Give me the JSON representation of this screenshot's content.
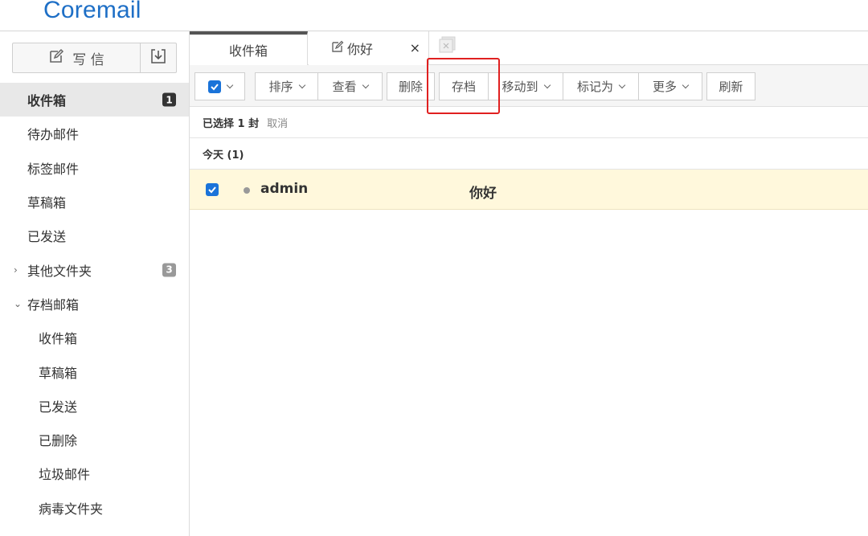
{
  "brand": {
    "logo_text": "Coremail",
    "accent": "#1e6fc6"
  },
  "sidebar": {
    "compose_label": "写 信",
    "compose_icon": "edit-icon",
    "import_icon": "import-icon",
    "items": [
      {
        "label": "收件箱",
        "badge": "1",
        "active": true
      },
      {
        "label": "待办邮件"
      },
      {
        "label": "标签邮件"
      },
      {
        "label": "草稿箱"
      },
      {
        "label": "已发送"
      },
      {
        "label": "其他文件夹",
        "badge": "3",
        "caret": "›"
      },
      {
        "label": "存档邮箱",
        "caret": "⌄"
      }
    ],
    "archive_items": [
      {
        "label": "收件箱"
      },
      {
        "label": "草稿箱"
      },
      {
        "label": "已发送"
      },
      {
        "label": "已删除"
      },
      {
        "label": "垃圾邮件"
      },
      {
        "label": "病毒文件夹"
      }
    ]
  },
  "tabs": [
    {
      "label": "收件箱",
      "active": true
    },
    {
      "label": "你好",
      "close": "×"
    }
  ],
  "toolbar": {
    "sort": "排序",
    "view": "查看",
    "delete": "删除",
    "archive": "存档",
    "move_to": "移动到",
    "mark_as": "标记为",
    "more": "更多",
    "refresh": "刷新"
  },
  "selection": {
    "text": "已选择 1 封",
    "cancel": "取消"
  },
  "list": {
    "group_label": "今天 (1)",
    "messages": [
      {
        "sender": "admin",
        "subject": "你好",
        "selected": true
      }
    ]
  },
  "colors": {
    "highlight": "#e02020",
    "selected_row": "#fff8dc",
    "checkbox": "#1a73d9"
  }
}
